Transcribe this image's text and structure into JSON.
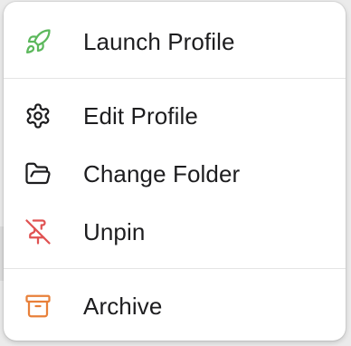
{
  "menu": {
    "items": [
      {
        "label": "Launch Profile",
        "icon": "rocket-icon",
        "color": "#5cb85c"
      },
      {
        "label": "Edit Profile",
        "icon": "gear-icon",
        "color": "#1d1d1f"
      },
      {
        "label": "Change Folder",
        "icon": "folder-open-icon",
        "color": "#1d1d1f"
      },
      {
        "label": "Unpin",
        "icon": "pin-off-icon",
        "color": "#e05252"
      },
      {
        "label": "Archive",
        "icon": "archive-icon",
        "color": "#e8803a"
      }
    ]
  }
}
